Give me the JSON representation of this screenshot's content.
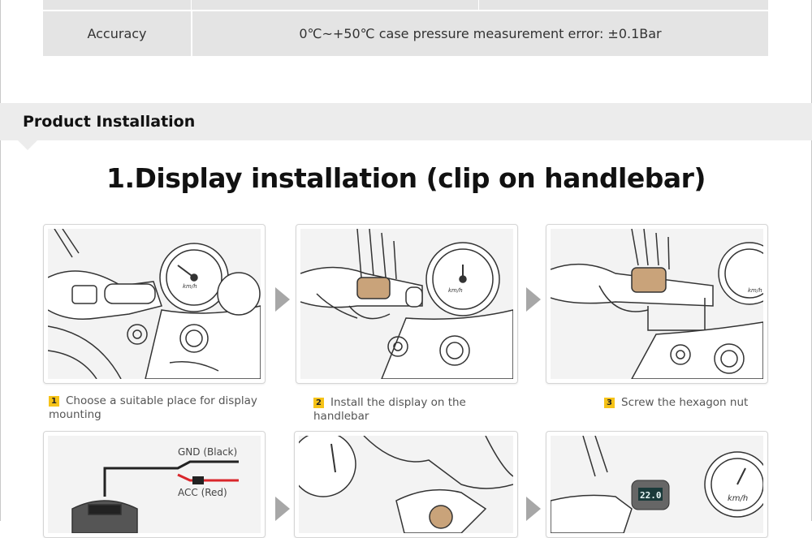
{
  "spec_table": {
    "rows": [
      {
        "label": "Accuracy",
        "value": "0℃~+50℃ case pressure measurement error: ±0.1Bar"
      }
    ]
  },
  "section": {
    "title": "Product Installation"
  },
  "installation": {
    "title": "1.Display installation (clip on handlebar)",
    "steps": [
      {
        "number": "1",
        "caption": "Choose a suitable place for display mounting"
      },
      {
        "number": "2",
        "caption": "Install the display on the handlebar"
      },
      {
        "number": "3",
        "caption": "Screw the hexagon nut"
      }
    ],
    "illustrations": {
      "speedo_unit": "km/h",
      "wire_gnd": "GND (Black)",
      "wire_acc": "ACC (Red)",
      "display_reading": "22.0"
    }
  },
  "colors": {
    "number_badge": "#f6c318",
    "header_band": "#ececec",
    "wire_red": "#d9262b"
  }
}
